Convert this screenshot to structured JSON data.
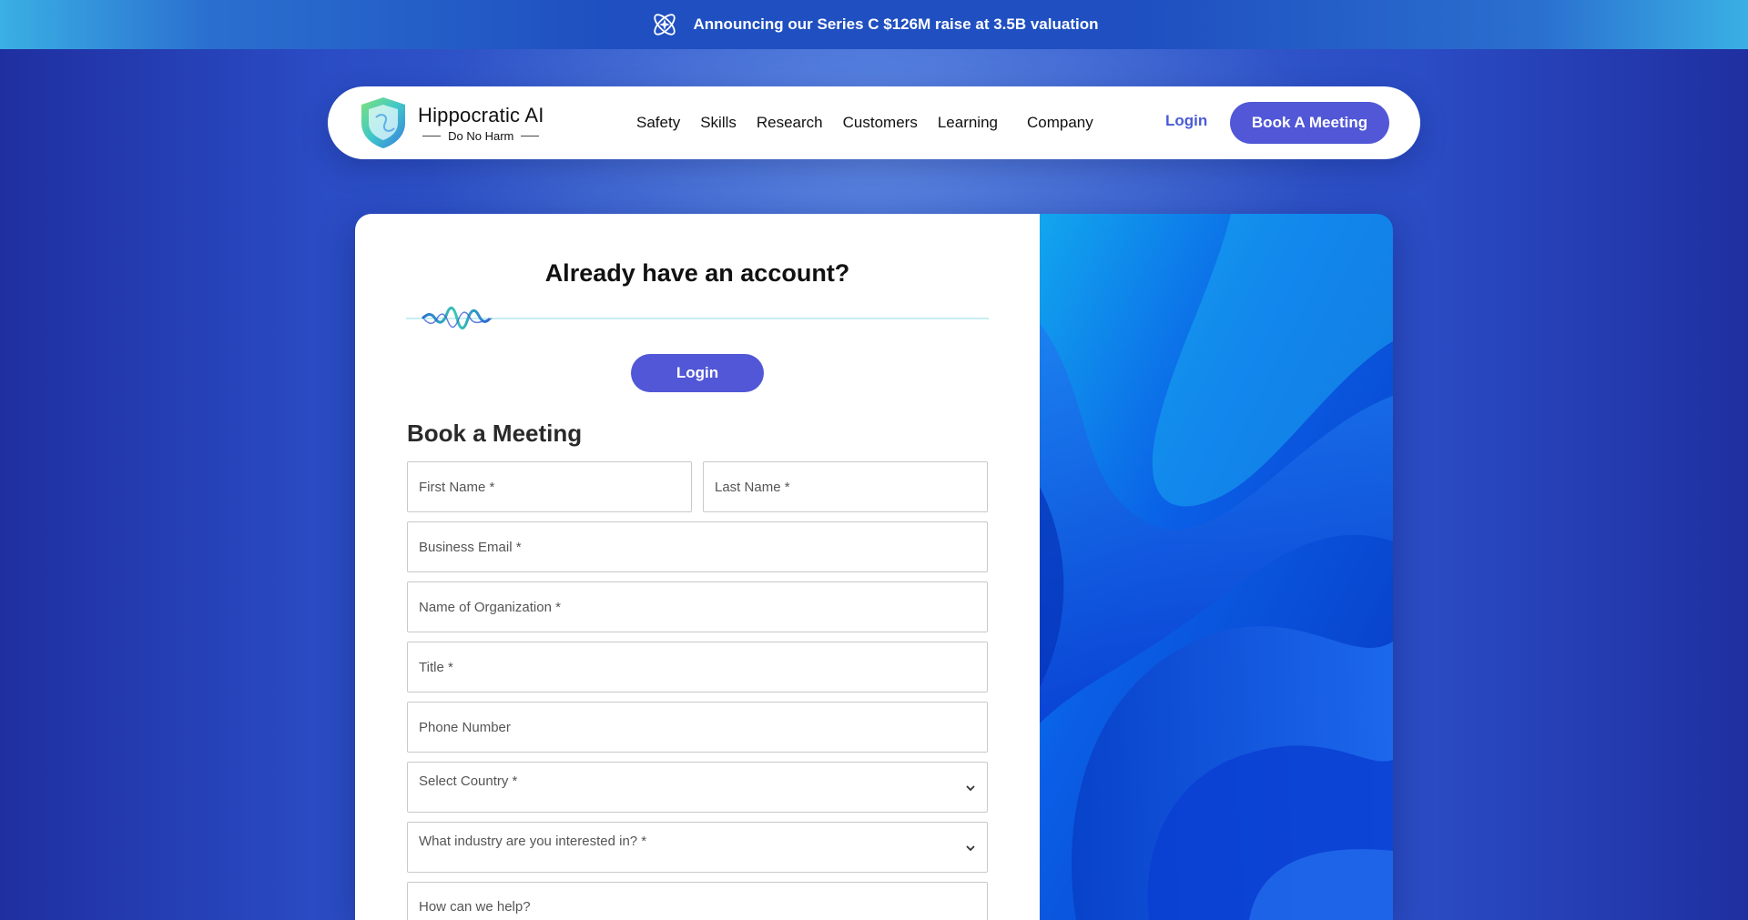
{
  "announcement": {
    "icon": "atom-sparkle-icon",
    "text": "Announcing our Series C $126M raise at 3.5B valuation"
  },
  "brand": {
    "name": "Hippocratic AI",
    "tagline": "Do No Harm",
    "logo": "shield-logo"
  },
  "nav": {
    "links": [
      "Safety",
      "Skills",
      "Research",
      "Customers",
      "Learning",
      "Company"
    ],
    "login": "Login",
    "book": "Book A Meeting"
  },
  "login_section": {
    "heading": "Already have an account?",
    "button": "Login"
  },
  "form": {
    "title": "Book a Meeting",
    "first_name": "First Name *",
    "last_name": "Last Name *",
    "email": "Business Email *",
    "organization": "Name of Organization *",
    "title_field": "Title *",
    "phone": "Phone Number",
    "country": "Select Country *",
    "industry": "What industry are you interested in? *",
    "help": "How can we help?"
  },
  "colors": {
    "accent": "#5157d6",
    "login_link": "#4a5bd6",
    "art_blue": "#0a4ee0"
  }
}
